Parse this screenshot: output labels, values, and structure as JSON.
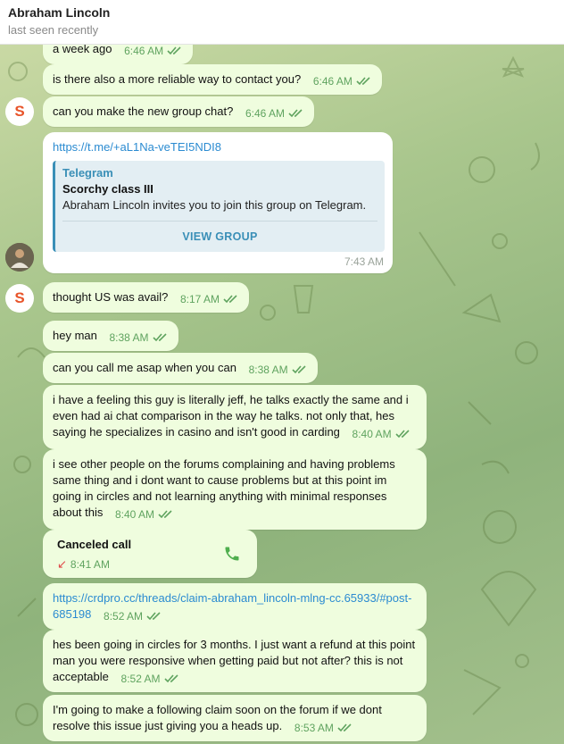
{
  "header": {
    "title": "Abraham Lincoln",
    "status": "last seen recently"
  },
  "messages": [
    {
      "text": "a week ago",
      "time": "6:46 AM"
    },
    {
      "text": "is there also a more reliable way to contact you?",
      "time": "6:46 AM"
    },
    {
      "text": "can you make the new group chat?",
      "time": "6:46 AM"
    },
    {
      "link": "https://t.me/+aL1Na-veTEI5NDI8",
      "time": "7:43 AM",
      "preview": {
        "site": "Telegram",
        "title": "Scorchy class III",
        "desc": "Abraham Lincoln invites you to join this group on Telegram.",
        "button": "VIEW GROUP"
      }
    },
    {
      "text": "thought US was avail?",
      "time": "8:17 AM"
    },
    {
      "text": "hey man",
      "time": "8:38 AM"
    },
    {
      "text": "can you call me asap when you can",
      "time": "8:38 AM"
    },
    {
      "text": "i have a feeling this guy is literally jeff, he talks exactly the same and i even had ai chat comparison in the way he talks. not only that, hes saying he specializes in casino and isn't good in carding",
      "time": "8:40 AM"
    },
    {
      "text": "i see other people on the forums complaining and having problems same thing and i dont want to cause problems but at this point im going in circles and not learning anything with minimal responses about this",
      "time": "8:40 AM"
    },
    {
      "call_title": "Canceled call",
      "time": "8:41 AM"
    },
    {
      "link": "https://crdpro.cc/threads/claim-abraham_lincoln-mlng-cc.65933/#post-685198",
      "time": "8:52 AM"
    },
    {
      "text": "hes been going in circles for 3 months. I just want a refund at this point man you were responsive when getting paid but not after? this is not acceptable",
      "time": "8:52 AM"
    },
    {
      "text": "I'm going to make a following claim soon on the forum if we dont resolve this issue just giving you a heads up.",
      "time": "8:53 AM"
    }
  ],
  "avatars": {
    "s_letter": "S"
  },
  "colors": {
    "bubble": "#effdde",
    "time": "#5fa35f",
    "link": "#2b8bd1",
    "accent": "#3a8fb7",
    "missed": "#e04a4a"
  }
}
